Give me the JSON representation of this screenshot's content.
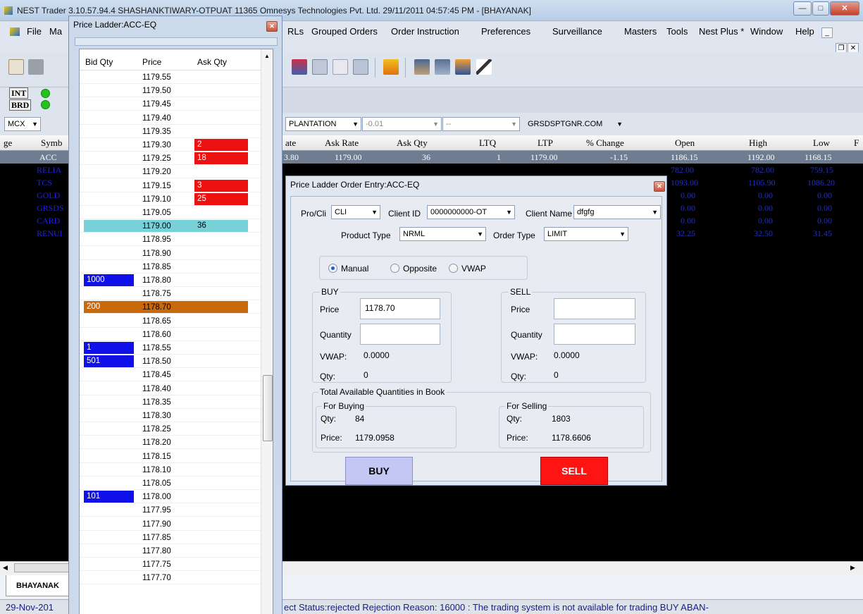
{
  "app": {
    "title": "NEST Trader 3.10.57.94.4 SHASHANKTIWARY-OTPUAT 11365 Omnesys Technologies Pvt. Ltd.  29/11/2011  04:57:45 PM - [BHAYANAK]",
    "menu_left": [
      "File",
      "Ma"
    ],
    "menu": [
      "RLs",
      "Grouped Orders",
      "Order Instruction",
      "Preferences",
      "Surveillance",
      "Masters",
      "Tools",
      "Nest Plus *",
      "Window",
      "Help"
    ]
  },
  "status_tags": [
    "INT",
    "BRD"
  ],
  "filters": {
    "exchange": "MCX",
    "series": "PLANTATION",
    "change": "-0.01",
    "blank": "--",
    "scrip": "GRSDSPTGNR.COM"
  },
  "market_watch": {
    "headers": [
      "ge",
      "Symb",
      "ate",
      "Ask Rate",
      "Ask Qty",
      "LTQ",
      "LTP",
      "% Change",
      "Open",
      "High",
      "Low",
      "F"
    ],
    "selected": {
      "symbol": "ACC",
      "rate": "3.80",
      "ask_rate": "1179.00",
      "ask_qty": "36",
      "ltq": "1",
      "ltp": "1179.00",
      "pct_change": "-1.15",
      "open": "1186.15",
      "high": "1192.00",
      "low": "1168.15"
    },
    "symbols": [
      "RELIA",
      "TCS",
      "GOLD",
      "GRSDS",
      "CARD",
      "RENUI"
    ],
    "right_rows": [
      [
        "782.00",
        "782.00",
        "759.15"
      ],
      [
        "1093.00",
        "1105.90",
        "1086.20"
      ],
      [
        "0.00",
        "0.00",
        "0.00"
      ],
      [
        "0.00",
        "0.00",
        "0.00"
      ],
      [
        "0.00",
        "0.00",
        "0.00"
      ],
      [
        "32.25",
        "32.50",
        "31.45"
      ]
    ]
  },
  "tab": "BHAYANAK",
  "statusbar": {
    "date": "29-Nov-201",
    "message": "ect  Status:rejected   Rejection Reason:   16000 : The trading system is not available for trading   BUY  ABAN-"
  },
  "price_ladder": {
    "title": "Price Ladder:ACC-EQ",
    "headers": [
      "Bid Qty",
      "Price",
      "Ask Qty"
    ],
    "prices": [
      "1179.55",
      "1179.50",
      "1179.45",
      "1179.40",
      "1179.35",
      "1179.30",
      "1179.25",
      "1179.20",
      "1179.15",
      "1179.10",
      "1179.05",
      "1179.00",
      "1178.95",
      "1178.90",
      "1178.85",
      "1178.80",
      "1178.75",
      "1178.70",
      "1178.65",
      "1178.60",
      "1178.55",
      "1178.50",
      "1178.45",
      "1178.40",
      "1178.35",
      "1178.30",
      "1178.25",
      "1178.20",
      "1178.15",
      "1178.10",
      "1178.05",
      "1178.00",
      "1177.95",
      "1177.90",
      "1177.85",
      "1177.80",
      "1177.75",
      "1177.70"
    ],
    "bids": {
      "1178.80": "1000",
      "1178.55": "1",
      "1178.50": "501",
      "1178.00": "101"
    },
    "asks": {
      "1179.30": "2",
      "1179.25": "18",
      "1179.15": "3",
      "1179.10": "25"
    },
    "ltp_price": "1179.00",
    "ltp_qty": "36",
    "order_price": "1178.70",
    "order_qty": "200",
    "colors": {
      "bid": "#1010e8",
      "ask": "#ee1111",
      "ltp": "#78d0d8",
      "order": "#c86a0c"
    }
  },
  "order_entry": {
    "title": "Price Ladder Order Entry:ACC-EQ",
    "pro_cli_label": "Pro/Cli",
    "pro_cli": "CLI",
    "client_id_label": "Client ID",
    "client_id": "0000000000-OT",
    "client_name_label": "Client Name",
    "client_name": "dfgfg",
    "product_type_label": "Product Type",
    "product_type": "NRML",
    "order_type_label": "Order Type",
    "order_type": "LIMIT",
    "modes": [
      "Manual",
      "Opposite",
      "VWAP"
    ],
    "buy": {
      "title": "BUY",
      "price_label": "Price",
      "price": "1178.70",
      "qty_label": "Quantity",
      "qty": "",
      "vwap_label": "VWAP:",
      "vwap": "0.0000",
      "qtylabel2": "Qty:",
      "qtyval": "0"
    },
    "sell": {
      "title": "SELL",
      "price_label": "Price",
      "price": "",
      "qty_label": "Quantity",
      "qty": "",
      "vwap_label": "VWAP:",
      "vwap": "0.0000",
      "qtylabel2": "Qty:",
      "qtyval": "0"
    },
    "totals": {
      "title": "Total Available Quantities in Book",
      "buying_title": "For Buying",
      "buying_qty_label": "Qty:",
      "buying_qty": "84",
      "buying_price_label": "Price:",
      "buying_price": "1179.0958",
      "selling_title": "For Selling",
      "selling_qty_label": "Qty:",
      "selling_qty": "1803",
      "selling_price_label": "Price:",
      "selling_price": "1178.6606"
    },
    "buy_button": "BUY",
    "sell_button": "SELL"
  }
}
